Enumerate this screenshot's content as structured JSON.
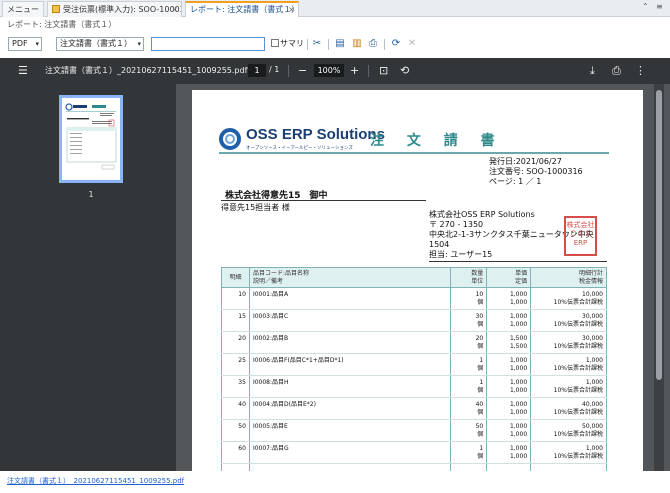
{
  "tabs": [
    {
      "label": "メニュー"
    },
    {
      "label": "受注伝票(標準入力): SOO-1000316"
    },
    {
      "label": "レポート: 注文請書（書式１）"
    }
  ],
  "breadcrumb": "レポート: 注文請書（書式１）",
  "toolbar": {
    "format_value": "PDF",
    "template_value": "注文請書（書式１）",
    "text_value": "",
    "summary_label": "サマリ"
  },
  "viewer": {
    "filename": "注文請書（書式１）_20210627115451_1009255.pdf",
    "page_current": "1",
    "page_total": "/ 1",
    "zoom": "100%",
    "thumb_number": "1"
  },
  "document": {
    "logo_text": "OSS ERP Solutions",
    "logo_subtext": "オープンソース・イーアールピー・ソリューションズ",
    "title": "注 文 請 書",
    "issue_date": "発行日:2021/06/27",
    "order_no": "注文番号: SOO-1000316",
    "page": "ページ: 1 ／ 1",
    "customer": "株式会社得意先15　御中",
    "customer_contact": "得意先15担当者 様",
    "issuer_lines": [
      "株式会社OSS ERP Solutions",
      "〒 270 - 1350",
      "中央北2-1-3サンクタス千葉ニュータウン中央",
      "1504",
      "担当: ユーザー15"
    ],
    "stamp_lines": [
      "株式会社",
      "ＯＳＳ",
      "ERP"
    ],
    "headers": {
      "line": "明細",
      "item": "品目コード:品目名称",
      "item2": "説明／備考",
      "qty": "数量",
      "unit": "単位",
      "price": "単価",
      "list_price": "定価",
      "total": "明細行計",
      "tax": "税金情報"
    },
    "rows": [
      {
        "line": "10",
        "item": "I0001:品目A",
        "qty": "10",
        "unit": "個",
        "price": "1,000",
        "list": "1,000",
        "total": "10,000",
        "tax": "10%伝票合計課税"
      },
      {
        "line": "15",
        "item": "I0003:品目C",
        "qty": "30",
        "unit": "個",
        "price": "1,000",
        "list": "1,000",
        "total": "30,000",
        "tax": "10%伝票合計課税"
      },
      {
        "line": "20",
        "item": "I0002:品目B",
        "qty": "20",
        "unit": "個",
        "price": "1,500",
        "list": "1,500",
        "total": "30,000",
        "tax": "10%伝票合計課税"
      },
      {
        "line": "25",
        "item": "I0006:品目F(品目C*1+品目D*1)",
        "qty": "1",
        "unit": "個",
        "price": "1,000",
        "list": "1,000",
        "total": "1,000",
        "tax": "10%伝票合計課税"
      },
      {
        "line": "35",
        "item": "I0008:品目H",
        "qty": "1",
        "unit": "個",
        "price": "1,000",
        "list": "1,000",
        "total": "1,000",
        "tax": "10%伝票合計課税"
      },
      {
        "line": "40",
        "item": "I0004:品目D(品目E*2)",
        "qty": "40",
        "unit": "個",
        "price": "1,000",
        "list": "1,000",
        "total": "40,000",
        "tax": "10%伝票合計課税"
      },
      {
        "line": "50",
        "item": "I0005:品目E",
        "qty": "50",
        "unit": "個",
        "price": "1,000",
        "list": "1,000",
        "total": "50,000",
        "tax": "10%伝票合計課税"
      },
      {
        "line": "60",
        "item": "I0007:品目G",
        "qty": "1",
        "unit": "個",
        "price": "1,000",
        "list": "1,000",
        "total": "1,000",
        "tax": "10%伝票合計課税"
      }
    ]
  },
  "footer_link": "注文請書（書式１）_20210627115451_1009255.pdf"
}
